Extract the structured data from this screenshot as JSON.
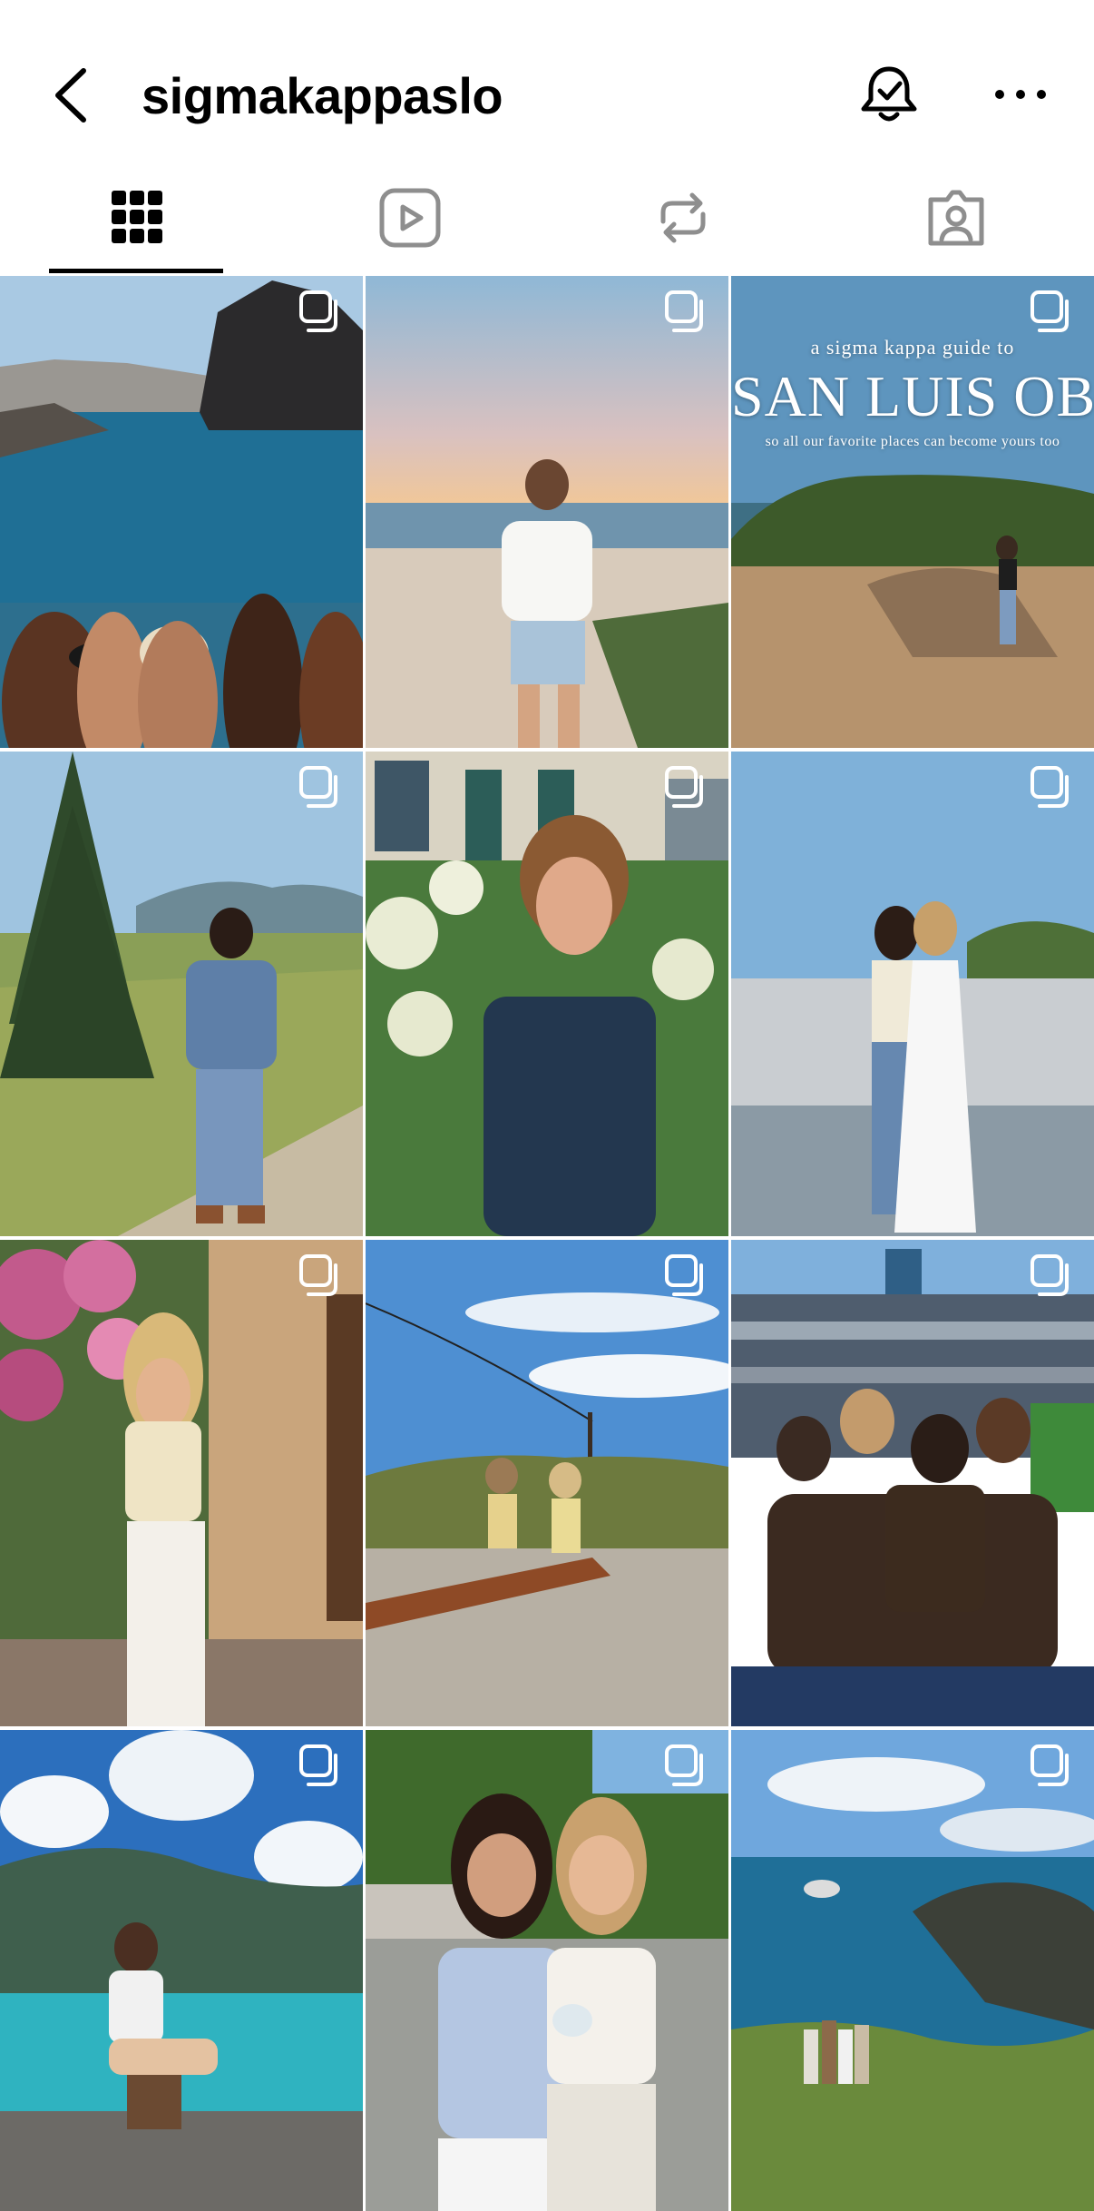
{
  "header": {
    "username": "sigmakappaslo",
    "back_icon": "chevron-left-icon",
    "bell_icon": "bell-check-icon",
    "more_icon": "more-horizontal-icon"
  },
  "tabs": [
    {
      "name": "grid",
      "icon": "grid-icon",
      "selected": true
    },
    {
      "name": "reels",
      "icon": "reels-icon",
      "selected": false
    },
    {
      "name": "reposts",
      "icon": "repost-icon",
      "selected": false
    },
    {
      "name": "tagged",
      "icon": "tagged-icon",
      "selected": false
    }
  ],
  "posts": [
    {
      "type": "carousel",
      "scene": "sea-cliffs-group"
    },
    {
      "type": "carousel",
      "scene": "beach-sunset"
    },
    {
      "type": "carousel",
      "scene": "slo-guide-cover",
      "overlay": {
        "line1": "a sigma kappa guide to",
        "line2": "SAN LUIS OBISPO",
        "line3": "so all our favorite places can become yours too"
      }
    },
    {
      "type": "carousel",
      "scene": "meadow-pine"
    },
    {
      "type": "carousel",
      "scene": "garden-hydrangea"
    },
    {
      "type": "carousel",
      "scene": "terrace-two-girls"
    },
    {
      "type": "carousel",
      "scene": "bougainvillea-wall"
    },
    {
      "type": "carousel",
      "scene": "hilltop-lights"
    },
    {
      "type": "carousel",
      "scene": "ballpark-group"
    },
    {
      "type": "carousel",
      "scene": "alpine-lake"
    },
    {
      "type": "carousel",
      "scene": "award-two-girls"
    },
    {
      "type": "carousel",
      "scene": "coastal-cliff"
    }
  ],
  "colors": {
    "text": "#000000",
    "icon_inactive": "#8e8e8e",
    "badge": "#ffffff"
  }
}
